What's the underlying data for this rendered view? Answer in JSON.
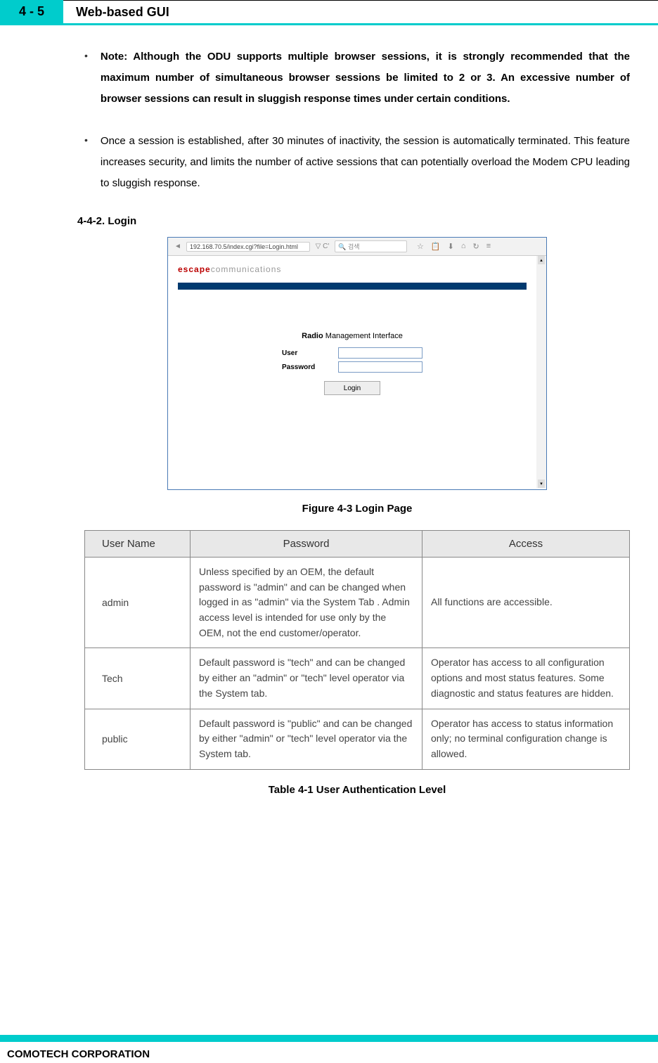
{
  "header": {
    "page_number": "4 - 5",
    "title": "Web-based GUI"
  },
  "bullets": [
    {
      "prefix": "Note: ",
      "bold": "Although the ODU supports multiple browser sessions, it is strongly recommended that the maximum number of simultaneous browser sessions be limited to 2 or 3. An excessive number of browser sessions can result in sluggish response times under certain conditions.",
      "normal": ""
    },
    {
      "prefix": "",
      "bold": "",
      "normal": "Once a session is established, after 30 minutes of inactivity, the session is automatically terminated. This feature increases security, and limits the number of active sessions that can potentially overload the Modem CPU leading to sluggish response."
    }
  ],
  "section_heading": "4-4-2. Login",
  "login_screenshot": {
    "url": "192.168.70.5/index.cgi?file=Login.html",
    "search_placeholder": "검색",
    "logo_red": "escape",
    "logo_gray": "communications",
    "form_title_bold": "Radio",
    "form_title_rest": " Management Interface",
    "user_label": "User",
    "password_label": "Password",
    "login_button": "Login"
  },
  "figure_caption": "Figure 4-3 Login Page",
  "table": {
    "headers": [
      "User Name",
      "Password",
      "Access"
    ],
    "rows": [
      {
        "user": "admin",
        "password": "Unless specified by an OEM, the default password is \"admin\" and can be changed when logged in as \"admin\" via the System Tab . Admin access level is intended for use only by the OEM, not the end customer/operator.",
        "access": "All functions are accessible."
      },
      {
        "user": "Tech",
        "password": "Default password is \"tech\" and can be changed by either an \"admin\" or \"tech\" level operator via the System tab.",
        "access": "Operator has access to all configuration options and most status features. Some diagnostic and status features are hidden."
      },
      {
        "user": "public",
        "password": "Default password is \"public\" and can be changed by either \"admin\" or \"tech\" level operator via the System tab.",
        "access": "Operator has access to status information only; no terminal configuration change is allowed."
      }
    ]
  },
  "table_caption": "Table 4-1 User Authentication Level",
  "footer": "COMOTECH CORPORATION"
}
